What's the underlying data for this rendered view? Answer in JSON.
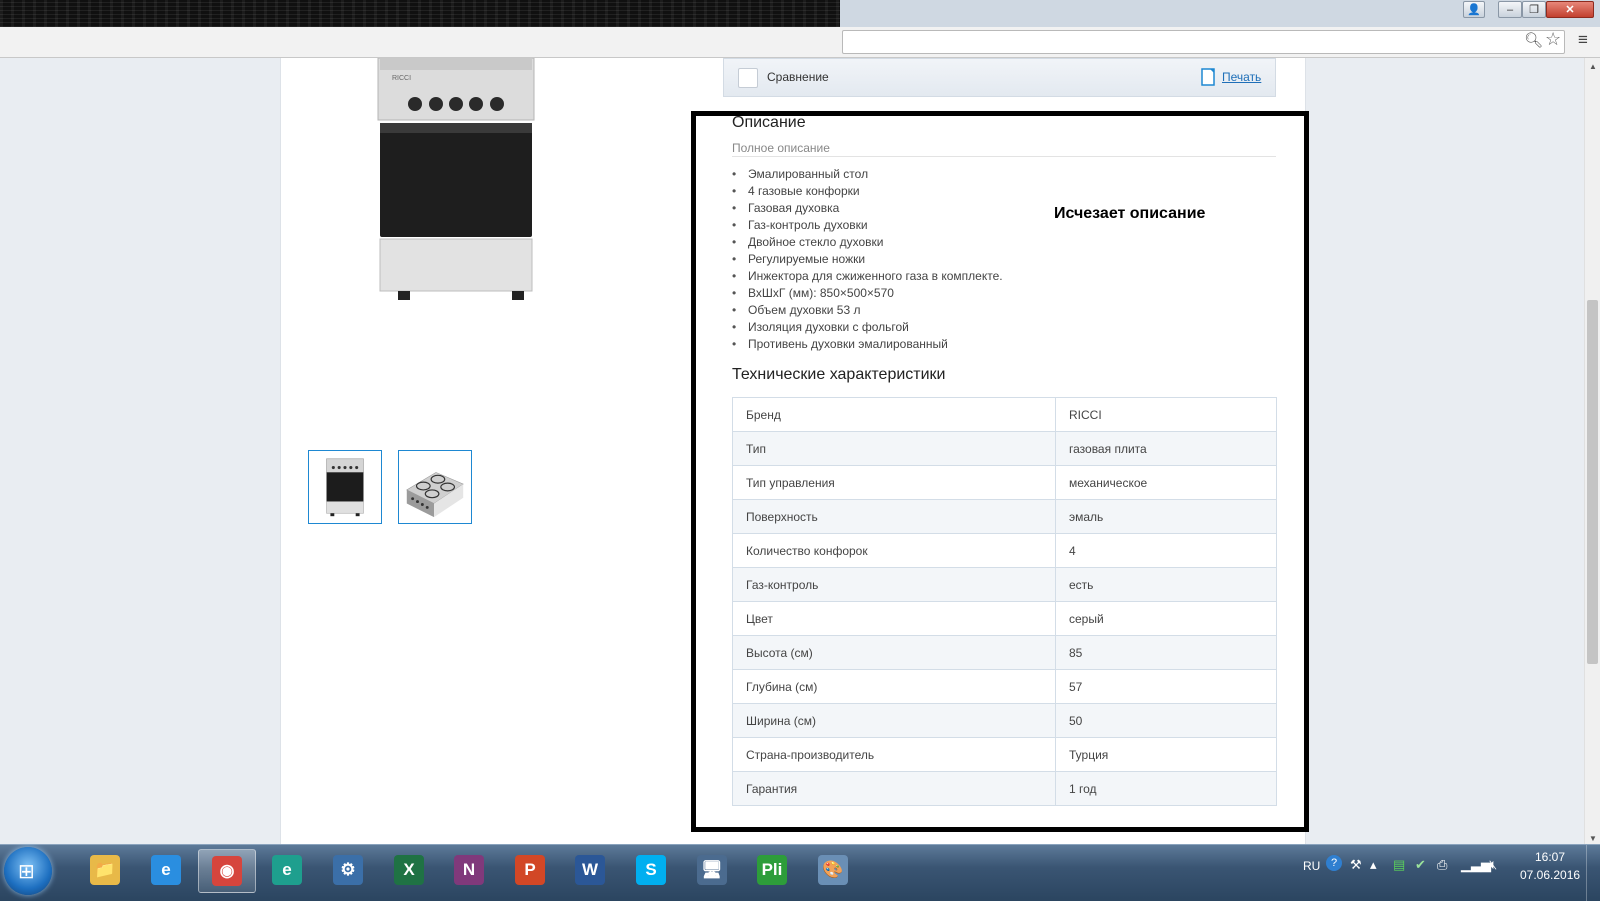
{
  "browser": {
    "window_buttons": {
      "user": "👤",
      "minimize": "–",
      "maximize": "❐",
      "close": "✕"
    },
    "icons": [
      "zoom-icon",
      "star-icon",
      "menu-icon"
    ]
  },
  "product": {
    "photo_alt": "",
    "thumbnails": [
      "thumb-front",
      "thumb-top"
    ]
  },
  "compare_bar": {
    "compare_label": "Сравнение",
    "print_label": "Печать"
  },
  "description": {
    "title": "Описание",
    "subtitle": "Полное описание",
    "features": [
      "Эмалированный стол",
      "4 газовые конфорки",
      "Газовая духовка",
      "Газ-контроль духовки",
      "Двойное стекло духовки",
      "Регулируемые ножки",
      "Инжектора для сжиженного газа в комплекте.",
      "ВхШхГ (мм): 850×500×570",
      "Объем духовки 53 л",
      "Изоляция духовки с фольгой",
      "Противень духовки эмалированный"
    ]
  },
  "annotation": {
    "text": "Исчезает описание"
  },
  "specs": {
    "title": "Технические характеристики",
    "rows": [
      {
        "key": "Бренд",
        "value": "RICCI"
      },
      {
        "key": "Тип",
        "value": "газовая плита"
      },
      {
        "key": "Тип управления",
        "value": "механическое"
      },
      {
        "key": "Поверхность",
        "value": "эмаль"
      },
      {
        "key": "Количество конфорок",
        "value": "4"
      },
      {
        "key": "Газ-контроль",
        "value": "есть"
      },
      {
        "key": "Цвет",
        "value": "серый"
      },
      {
        "key": "Высота (см)",
        "value": "85"
      },
      {
        "key": "Глубина (см)",
        "value": "57"
      },
      {
        "key": "Ширина (см)",
        "value": "50"
      },
      {
        "key": "Страна-производитель",
        "value": "Турция"
      },
      {
        "key": "Гарантия",
        "value": "1 год"
      }
    ]
  },
  "taskbar": {
    "apps": [
      {
        "name": "explorer",
        "glyph": "📁",
        "color": "#e8b948"
      },
      {
        "name": "internet-explorer",
        "glyph": "e",
        "color": "#2a8ee0"
      },
      {
        "name": "chrome",
        "glyph": "◉",
        "color": "#d6453d"
      },
      {
        "name": "edge-e",
        "glyph": "e",
        "color": "#1e9f8e"
      },
      {
        "name": "settings",
        "glyph": "⚙",
        "color": "#3b6fa8"
      },
      {
        "name": "excel",
        "glyph": "X",
        "color": "#1f7244"
      },
      {
        "name": "onenote",
        "glyph": "N",
        "color": "#80397b"
      },
      {
        "name": "powerpoint",
        "glyph": "P",
        "color": "#d24726"
      },
      {
        "name": "word",
        "glyph": "W",
        "color": "#2b5797"
      },
      {
        "name": "skype",
        "glyph": "S",
        "color": "#00aff0"
      },
      {
        "name": "network-monitor",
        "glyph": "🖥",
        "color": "#4b6b8f"
      },
      {
        "name": "pli-app",
        "glyph": "Pli",
        "color": "#2d9d3a"
      },
      {
        "name": "paint",
        "glyph": "🎨",
        "color": "#6a8fb5"
      }
    ],
    "active_app": "chrome",
    "tray_lang": "RU",
    "tray_help": "?",
    "clock_time": "16:07",
    "clock_date": "07.06.2016"
  }
}
